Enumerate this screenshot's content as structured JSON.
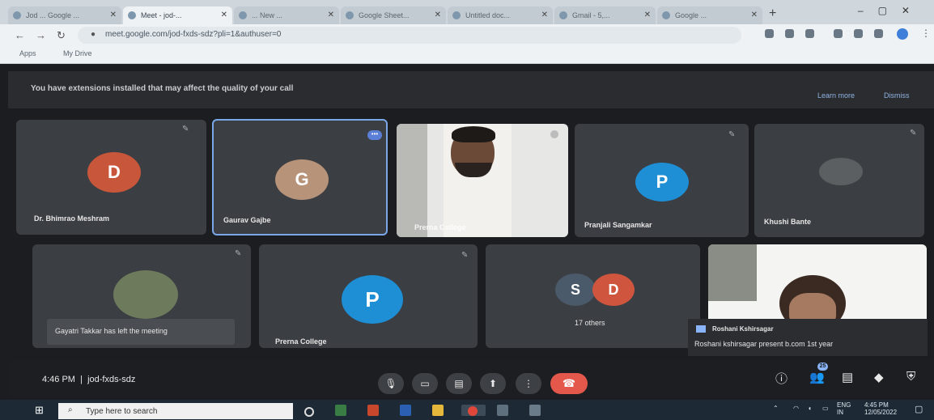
{
  "browser": {
    "tabs": [
      {
        "title": "Jod ... Google ..."
      },
      {
        "title": "Meet - jod-..."
      },
      {
        "title": "... New ..."
      },
      {
        "title": "Google Sheet..."
      },
      {
        "title": "Untitled doc..."
      },
      {
        "title": "Gmail - 5,..."
      },
      {
        "title": "Google ..."
      }
    ],
    "url": "meet.google.com/jod-fxds-sdz?pli=1&authuser=0",
    "bookmarks": [
      "Apps",
      "My Drive"
    ]
  },
  "banner": {
    "message": "You have extensions installed that may affect the quality of your call",
    "learn_more": "Learn more",
    "dismiss": "Dismiss"
  },
  "participants": [
    {
      "name": "Dr. Bhimrao Meshram",
      "initial": "D",
      "color": "#c8563b"
    },
    {
      "name": "Gaurav Gajbe",
      "initial": "G",
      "color": "#b7937a"
    },
    {
      "name": "Prerna College",
      "initial": "",
      "color": "#ffffff"
    },
    {
      "name": "Pranjali Sangamkar",
      "initial": "P",
      "color": "#1e8fd4"
    },
    {
      "name": "Khushi Bante",
      "initial": "",
      "color": "#444"
    },
    {
      "name": "Gayatri Takkar has left the meeting",
      "initial": "",
      "color": "#444"
    },
    {
      "name": "Prerna College",
      "initial": "P",
      "color": "#1e8fd4"
    },
    {
      "name": "17 others",
      "initial": "S",
      "initial2": "D",
      "color": "#4a5a6a",
      "color2": "#d0553e"
    },
    {
      "name": "Roshani Kshirsagar",
      "initial": "",
      "color": "#fff"
    }
  ],
  "chat_snippet": "Roshani kshirsagar present b.com 1st year",
  "meeting": {
    "time": "4:46 PM",
    "separator": "|",
    "code": "jod-fxds-sdz",
    "participant_count": "25"
  },
  "taskbar": {
    "search_placeholder": "Type here to search",
    "lang": "ENG",
    "region": "IN",
    "clock_time": "4:45 PM",
    "clock_date": "12/05/2022"
  }
}
